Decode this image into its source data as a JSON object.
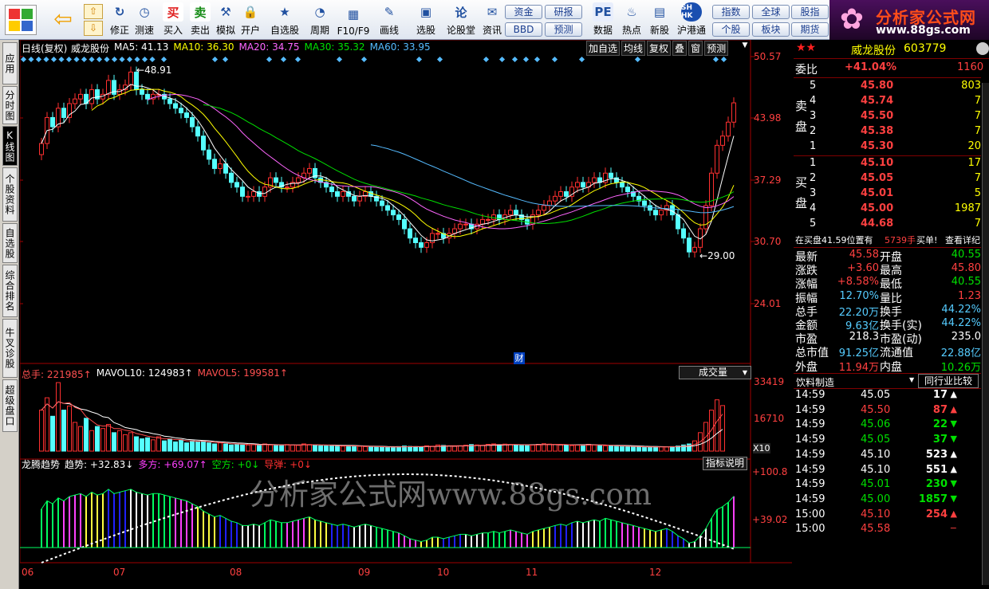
{
  "toolbar": {
    "buttons": [
      {
        "label": "修正",
        "icon": "refresh-icon"
      },
      {
        "label": "测速",
        "icon": "clock-icon"
      },
      {
        "label": "买入",
        "icon": "buy-icon",
        "glyph": "买",
        "color": "#e02020"
      },
      {
        "label": "卖出",
        "icon": "sell-icon",
        "glyph": "卖",
        "color": "#138a13"
      },
      {
        "label": "模拟",
        "icon": "hammer-icon"
      },
      {
        "label": "开户",
        "icon": "lock-icon"
      },
      {
        "label": "自选股",
        "icon": "star-icon"
      },
      {
        "label": "周期",
        "icon": "period-icon"
      },
      {
        "label": "F10/F9",
        "icon": "info-icon"
      },
      {
        "label": "画线",
        "icon": "pen-icon"
      },
      {
        "label": "选股",
        "icon": "screen-icon"
      },
      {
        "label": "论股堂",
        "icon": "forum-icon",
        "glyph": "论"
      },
      {
        "label": "资讯",
        "icon": "news-icon"
      },
      {
        "label": "数据",
        "icon": "pe-icon",
        "glyph": "PE"
      },
      {
        "label": "热点",
        "icon": "fire-icon"
      },
      {
        "label": "新股",
        "icon": "newstock-icon"
      },
      {
        "label": "沪港通",
        "icon": "hk-icon",
        "glyph": "SH HK"
      }
    ],
    "small_buttons": [
      [
        "资金",
        "BBD"
      ],
      [
        "研报",
        "预测"
      ]
    ],
    "right_buttons": [
      [
        "指数",
        "个股"
      ],
      [
        "全球",
        "板块"
      ],
      [
        "股指",
        "期货"
      ]
    ]
  },
  "logo": {
    "title": "分析家公式网",
    "url": "www.88gs.com"
  },
  "left_tabs": [
    "应用",
    "分时图",
    "K线图",
    "个股资料",
    "自选股",
    "综合排名",
    "牛叉诊股",
    "超级盘口"
  ],
  "kline": {
    "header": {
      "name": "日线(复权)",
      "stock": "威龙股份"
    },
    "ma_labels": [
      {
        "text": "MA5: 41.13",
        "color": "#ffffff"
      },
      {
        "text": "MA10: 36.30",
        "color": "#ffff00"
      },
      {
        "text": "MA20: 34.75",
        "color": "#ff66ff"
      },
      {
        "text": "MA30: 35.32",
        "color": "#00e000"
      },
      {
        "text": "MA60: 33.95",
        "color": "#55bbff"
      }
    ],
    "tools": [
      "加自选",
      "均线",
      "复权",
      "叠",
      "窗",
      "预测"
    ],
    "price_axis": [
      "50.57",
      "43.98",
      "37.29",
      "30.70",
      "24.01"
    ],
    "high_label": "48.91",
    "low_label": "29.00",
    "event_mark": "财"
  },
  "volume": {
    "labels": [
      {
        "text": "总手: 221985↑",
        "color": "#ff5050"
      },
      {
        "text": "MAVOL10: 124983↑",
        "color": "#ffffff"
      },
      {
        "text": "MAVOL5: 199581↑",
        "color": "#ff5050"
      }
    ],
    "axis": [
      "33419",
      "16710"
    ],
    "multiplier": "X10",
    "dropdown": "成交量"
  },
  "indicator": {
    "labels": [
      {
        "text": "龙腾趋势",
        "color": "#ffffff"
      },
      {
        "text": "趋势: +32.83↓",
        "color": "#ffffff"
      },
      {
        "text": "多方: +69.07↑",
        "color": "#ff40ff"
      },
      {
        "text": "空方: +0↓",
        "color": "#00e000"
      },
      {
        "text": "导弹: +0↓",
        "color": "#ff3030"
      }
    ],
    "axis": [
      "+100.8",
      "+39.02"
    ],
    "button": "指标说明"
  },
  "watermark": "分析家公式网www.88gs.com",
  "x_axis": [
    "06",
    "07",
    "08",
    "09",
    "10",
    "11",
    "12"
  ],
  "quote": {
    "stock_name": "威龙股份",
    "code": "603779",
    "weibi_label": "委比",
    "weibi": "+41.04%",
    "weicha": "1160",
    "sell_label": "卖盘",
    "buy_label": "买盘",
    "asks": [
      {
        "level": "5",
        "price": "45.80",
        "vol": "803"
      },
      {
        "level": "4",
        "price": "45.74",
        "vol": "7"
      },
      {
        "level": "3",
        "price": "45.50",
        "vol": "7"
      },
      {
        "level": "2",
        "price": "45.38",
        "vol": "7"
      },
      {
        "level": "1",
        "price": "45.30",
        "vol": "20"
      }
    ],
    "bids": [
      {
        "level": "1",
        "price": "45.10",
        "vol": "17"
      },
      {
        "level": "2",
        "price": "45.05",
        "vol": "7"
      },
      {
        "level": "3",
        "price": "45.01",
        "vol": "5"
      },
      {
        "level": "4",
        "price": "45.00",
        "vol": "1987"
      },
      {
        "level": "5",
        "price": "44.68",
        "vol": "7"
      }
    ],
    "notice": [
      "在买盘41.59位置有",
      "5739手",
      "买单!",
      "查看详纪"
    ],
    "stats": [
      [
        "最新",
        "45.58",
        "#ff4040",
        "开盘",
        "40.55",
        "#00e000"
      ],
      [
        "涨跌",
        "+3.60",
        "#ff4040",
        "最高",
        "45.80",
        "#ff4040"
      ],
      [
        "涨幅",
        "+8.58%",
        "#ff4040",
        "最低",
        "40.55",
        "#00e000"
      ],
      [
        "振幅",
        "12.70%",
        "#55ccff",
        "量比",
        "1.23",
        "#ff4040"
      ],
      [
        "总手",
        "22.20万",
        "#55ccff",
        "换手",
        "44.22%",
        "#55ccff"
      ],
      [
        "金额",
        "9.63亿",
        "#55ccff",
        "换手(实)",
        "44.22%",
        "#55ccff"
      ],
      [
        "市盈",
        "218.3",
        "#ffffff",
        "市盈(动)",
        "235.0",
        "#ffffff"
      ],
      [
        "总市值",
        "91.25亿",
        "#55ccff",
        "流通值",
        "22.88亿",
        "#55ccff"
      ],
      [
        "外盘",
        "11.94万",
        "#ff4040",
        "内盘",
        "10.26万",
        "#00e000"
      ]
    ],
    "industry": "饮料制造",
    "compare": "同行业比较",
    "ticks": [
      {
        "time": "14:59",
        "price": "45.05",
        "vol": "17",
        "color": "#ffffff",
        "dir": "up-arrow-icon"
      },
      {
        "time": "14:59",
        "price": "45.50",
        "vol": "87",
        "color": "#ff4040",
        "dir": "up-arrow-icon"
      },
      {
        "time": "14:59",
        "price": "45.06",
        "vol": "22",
        "color": "#00e000",
        "dir": "down-arrow-icon"
      },
      {
        "time": "14:59",
        "price": "45.05",
        "vol": "37",
        "color": "#00e000",
        "dir": "down-arrow-icon"
      },
      {
        "time": "14:59",
        "price": "45.10",
        "vol": "523",
        "color": "#ffffff",
        "dir": "up-arrow-icon"
      },
      {
        "time": "14:59",
        "price": "45.10",
        "vol": "551",
        "color": "#ffffff",
        "dir": "up-arrow-icon"
      },
      {
        "time": "14:59",
        "price": "45.01",
        "vol": "230",
        "color": "#00e000",
        "dir": "down-arrow-icon"
      },
      {
        "time": "14:59",
        "price": "45.00",
        "vol": "1857",
        "color": "#00e000",
        "dir": "down-arrow-icon"
      },
      {
        "time": "15:00",
        "price": "45.10",
        "vol": "254",
        "color": "#ff4040",
        "dir": "up-arrow-icon"
      },
      {
        "time": "15:00",
        "price": "45.58",
        "vol": "",
        "color": "#ff4040",
        "dir": "dash-icon"
      }
    ]
  },
  "chart_data": {
    "type": "candlestick",
    "x_ticks": [
      "06",
      "07",
      "08",
      "09",
      "10",
      "11",
      "12"
    ],
    "price_range": [
      24.01,
      50.57
    ],
    "y_ticks": [
      50.57,
      43.98,
      37.29,
      30.7,
      24.01
    ],
    "annotations": [
      {
        "text": "48.91",
        "value": 48.91
      },
      {
        "text": "29.00",
        "value": 29.0
      }
    ],
    "close_series": [
      41.2,
      44.0,
      43.0,
      45.0,
      44.0,
      45.5,
      46.0,
      46.5,
      45.5,
      47.0,
      46.0,
      46.5,
      48.0,
      46.5,
      47.0,
      47.5,
      48.9,
      47.0,
      46.5,
      46.0,
      46.5,
      46.5,
      46.0,
      45.5,
      45.0,
      44.5,
      44.0,
      43.0,
      42.0,
      40.5,
      39.5,
      38.5,
      39.0,
      38.0,
      37.0,
      36.5,
      35.5,
      35.5,
      36.0,
      35.5,
      36.5,
      37.5,
      37.0,
      36.5,
      36.5,
      37.0,
      37.5,
      38.0,
      38.5,
      37.5,
      37.0,
      36.5,
      36.0,
      35.5,
      36.0,
      35.5,
      35.0,
      35.5,
      36.0,
      35.5,
      35.0,
      34.5,
      34.0,
      33.5,
      33.0,
      32.0,
      31.0,
      30.5,
      30.0,
      30.5,
      31.5,
      31.5,
      31.0,
      31.5,
      32.0,
      32.5,
      32.5,
      32.0,
      32.5,
      33.0,
      33.0,
      33.5,
      33.0,
      33.5,
      34.0,
      33.5,
      33.0,
      32.5,
      33.5,
      34.0,
      34.5,
      35.0,
      35.5,
      36.0,
      35.5,
      36.5,
      37.0,
      36.5,
      37.0,
      37.5,
      37.0,
      38.0,
      37.5,
      37.0,
      36.5,
      36.0,
      35.5,
      35.0,
      34.5,
      34.0,
      33.5,
      34.0,
      34.5,
      33.5,
      32.0,
      31.0,
      29.5,
      30.0,
      32.0,
      34.5,
      38.0,
      41.0,
      42.0,
      43.5,
      45.58
    ],
    "volume_series": [
      20000,
      26000,
      17000,
      33400,
      20000,
      22000,
      14000,
      12000,
      16000,
      10000,
      12000,
      11000,
      13000,
      9000,
      10000,
      8000,
      9000,
      7000,
      6000,
      6500,
      5500,
      7000,
      5000,
      6000,
      4500,
      5500,
      4000,
      5000,
      4500,
      5000,
      4000,
      3500,
      4000,
      3500,
      3000,
      3500,
      3000,
      3000,
      3200,
      2800,
      3500,
      3000,
      2800,
      3000,
      3200,
      3000,
      2800,
      3500,
      3200,
      3000,
      2600,
      2500,
      2800,
      2600,
      2400,
      2500,
      2300,
      2400,
      2200,
      2000,
      2100,
      2000,
      1800,
      2000,
      2200,
      2500,
      2300,
      2200,
      2100,
      2600,
      2400,
      3000,
      2800,
      2500,
      2300,
      2600,
      2900,
      3200,
      3000,
      2800,
      3300,
      3500,
      3200,
      3400,
      3100,
      3000,
      2900,
      2800,
      3000,
      3300,
      3600,
      3400,
      3200,
      3000,
      2800,
      2700,
      2900,
      3100,
      3300,
      3000,
      2800,
      2600,
      2500,
      2400,
      2300,
      2200,
      2100,
      2000,
      1900,
      2000,
      2200,
      2100,
      2000,
      2200,
      2500,
      3000,
      3500,
      5000,
      9000,
      14000,
      20000,
      25000,
      22198
    ]
  }
}
